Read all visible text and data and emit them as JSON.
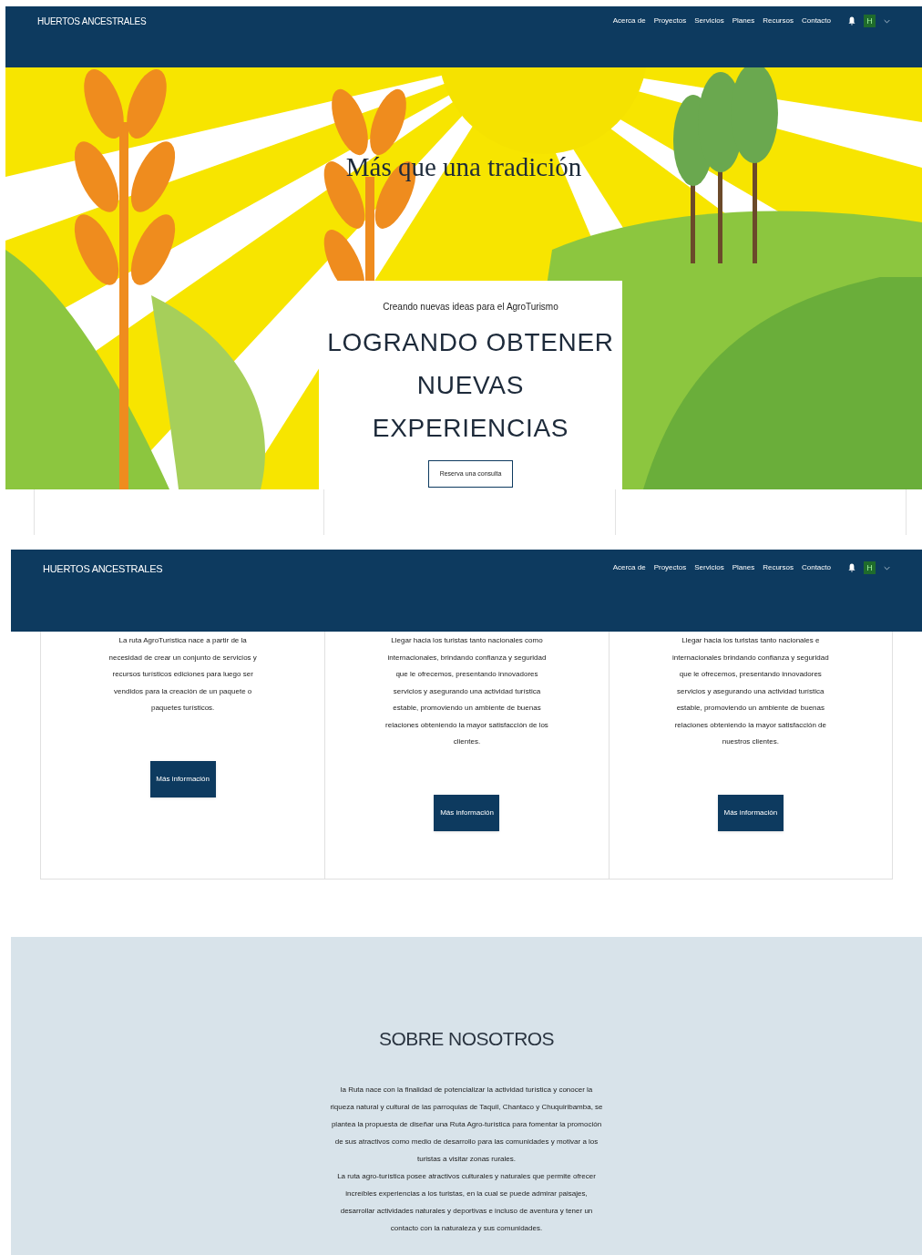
{
  "top_screen": {
    "header": {
      "brand": "HUERTOS ANCESTRALES",
      "nav": [
        "Acerca de",
        "Proyectos",
        "Servicios",
        "Planes",
        "Recursos",
        "Contacto"
      ],
      "avatar": "H"
    },
    "hero": {
      "title": "Más que una tradición",
      "card": {
        "subtitle": "Creando nuevas ideas para el AgroTurismo",
        "heading": [
          "LOGRANDO OBTENER",
          "NUEVAS",
          "EXPERIENCIAS"
        ],
        "button": "Reserva una consulta"
      }
    }
  },
  "bottom_screen": {
    "header": {
      "brand": "HUERTOS ANCESTRALES",
      "nav": [
        "Acerca de",
        "Proyectos",
        "Servicios",
        "Planes",
        "Recursos",
        "Contacto"
      ],
      "avatar": "H"
    },
    "cards": [
      {
        "text": "La ruta AgroTurística nace a partir de la necesidad de crear un conjunto de servicios y recursos turísticos ediciones para luego ser vendidos para la creación de un paquete o paquetes turísticos.",
        "button": "Más información"
      },
      {
        "text": "Llegar hacia los turistas tanto nacionales como internacionales, brindando confianza y seguridad que le ofrecemos, presentando innovadores servicios y asegurando una actividad turística estable, promoviendo un ambiente de buenas relaciones obteniendo la mayor satisfacción de los clientes.",
        "button": "Más información"
      },
      {
        "text": "Llegar hacia los turistas tanto nacionales e internacionales brindando confianza y seguridad que le ofrecemos, presentando innovadores servicios y asegurando una actividad turística estable, promoviendo un ambiente de buenas relaciones obteniendo la mayor satisfacción de nuestros clientes.",
        "button": "Más información"
      }
    ],
    "about": {
      "title": "SOBRE NOSOTROS",
      "paragraphs": [
        "la Ruta nace con la finalidad de potencializar la actividad turística y conocer la riqueza natural y cultural de las parroquias de Taquil, Chantaco y Chuquiribamba, se plantea la propuesta de diseñar una Ruta Agro-turística para fomentar la promoción de sus atractivos como medio de desarrollo para las comunidades y motivar a los turistas a visitar zonas rurales.",
        "La ruta agro-turística posee atractivos culturales y naturales que permite ofrecer increíbles experiencias a los turistas, en la cual se puede admirar paisajes, desarrollar actividades naturales y deportivas e incluso de aventura y tener un contacto con la naturaleza y sus comunidades."
      ]
    }
  }
}
